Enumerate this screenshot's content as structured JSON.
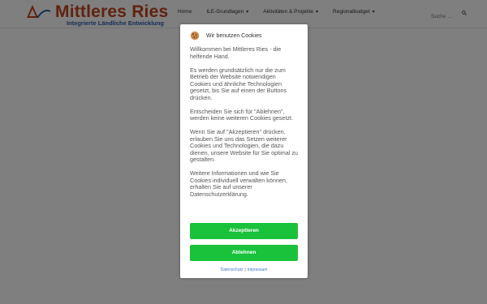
{
  "site": {
    "logo_title": "Mittleres Ries",
    "logo_subtitle": "Integrierte Ländliche Entwicklung",
    "nav": [
      {
        "label": "Home",
        "has_dropdown": false
      },
      {
        "label": "ILE-Grundlagen",
        "has_dropdown": true
      },
      {
        "label": "Aktivitäten & Projekte",
        "has_dropdown": true
      },
      {
        "label": "Regionalbudget",
        "has_dropdown": true
      }
    ],
    "search_placeholder": "Suche ...",
    "dropdown_caret": "▾",
    "search_icon": "search-icon"
  },
  "cookie_modal": {
    "title": "Wir benutzen Cookies",
    "paragraphs": [
      "Willkommen bei Mittleres Ries - die helfende Hand.",
      "Es werden grundsätzlich nur die zum Betrieb der Website notwendigen Cookies und ähnliche Technologien gesetzt, bis Sie auf einen der Buttons drücken.",
      "Entscheiden Sie sich für \"Ablehnen\", werden keine weiteren Cookies gesetzt.",
      "Wenn Sie auf \"Akzeptieren\" drücken, erlauben Sie uns das Setzen weiterer Cookies und Technologien, die dazu dienen, unsere Website für Sie optimal zu gestalten.",
      "Weitere Informationen und wie Sie Cookies individuell verwalten können, erhalten Sie auf unserer Datenschutzerklärung."
    ],
    "accept_label": "Akzeptieren",
    "reject_label": "Ablehnen",
    "link_privacy": "Datenschutz",
    "link_separator": "|",
    "link_imprint": "Impressum",
    "colors": {
      "button": "#19c23a",
      "link": "#3a78c9",
      "brand_red": "#c0451c",
      "brand_blue": "#2a5ea8"
    }
  }
}
